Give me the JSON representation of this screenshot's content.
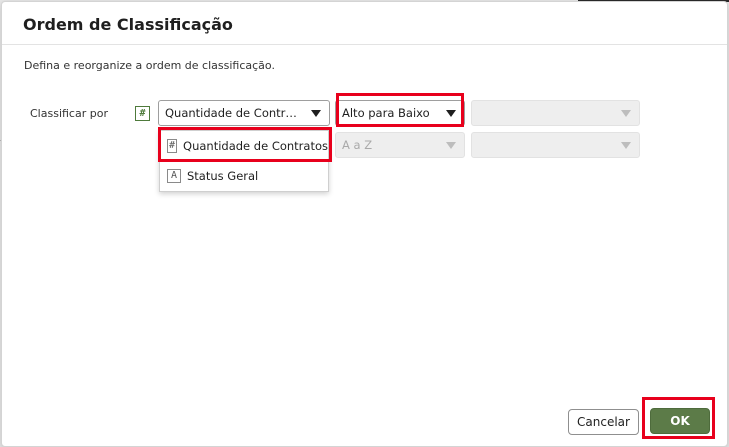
{
  "dialog": {
    "title": "Ordem de Classificação",
    "description": "Defina e reorganize a ordem de classificação.",
    "sort_label": "Classificar por"
  },
  "row1": {
    "type_icon_glyph": "#",
    "column_value": "Quantidade de Contr…",
    "order_value": "Alto para Baixo",
    "extra_value": ""
  },
  "row2": {
    "order_value": "A a Z",
    "extra_value": ""
  },
  "dropdown": {
    "items": [
      {
        "glyph": "#",
        "label": "Quantidade de Contratos",
        "icon": "number-type-icon"
      },
      {
        "glyph": "A",
        "label": "Status Geral",
        "icon": "text-type-icon"
      }
    ]
  },
  "buttons": {
    "cancel_label": "Cancelar",
    "ok_label": "OK"
  },
  "colors": {
    "accent_green": "#5c7b48",
    "highlight_red": "#e8001c"
  }
}
